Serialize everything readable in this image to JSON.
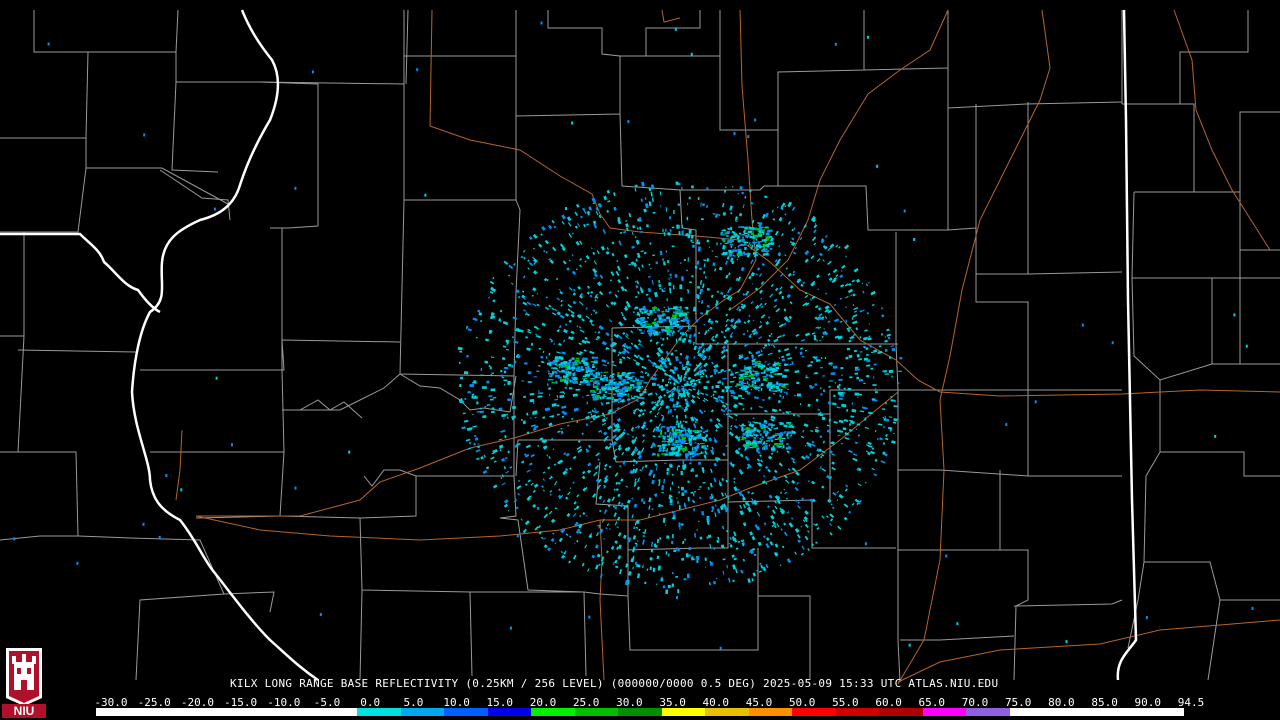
{
  "title": "KILX LONG RANGE BASE REFLECTIVITY (0.25KM / 256 LEVEL) (000000/0000 0.5 DEG) 2025-05-09 15:33 UTC  ATLAS.NIU.EDU",
  "logo_text": "NIU",
  "scale": {
    "labels": [
      "-30.0",
      "-25.0",
      "-20.0",
      "-15.0",
      "-10.0",
      "-5.0",
      "0.0",
      "5.0",
      "10.0",
      "15.0",
      "20.0",
      "25.0",
      "30.0",
      "35.0",
      "40.0",
      "45.0",
      "50.0",
      "55.0",
      "60.0",
      "65.0",
      "70.0",
      "75.0",
      "80.0",
      "85.0",
      "90.0",
      "94.5"
    ],
    "colors": [
      "#ffffff",
      "#ffffff",
      "#ffffff",
      "#ffffff",
      "#ffffff",
      "#ffffff",
      "#00e0e0",
      "#00a8f0",
      "#0060ff",
      "#0000e8",
      "#00f000",
      "#00c000",
      "#009000",
      "#ffff00",
      "#e8c000",
      "#ff9000",
      "#ff0000",
      "#d00000",
      "#b00000",
      "#ff00ff",
      "#9060e0",
      "#ffffff",
      "#ffffff",
      "#ffffff",
      "#ffffff"
    ]
  },
  "colors": {
    "state_border": "#ffffff",
    "county_border": "#9a9a9a",
    "highway": "#b5652a",
    "echo_light": "#00d0d8",
    "echo_mid": "#0090f0",
    "echo_strong": "#00c000"
  }
}
